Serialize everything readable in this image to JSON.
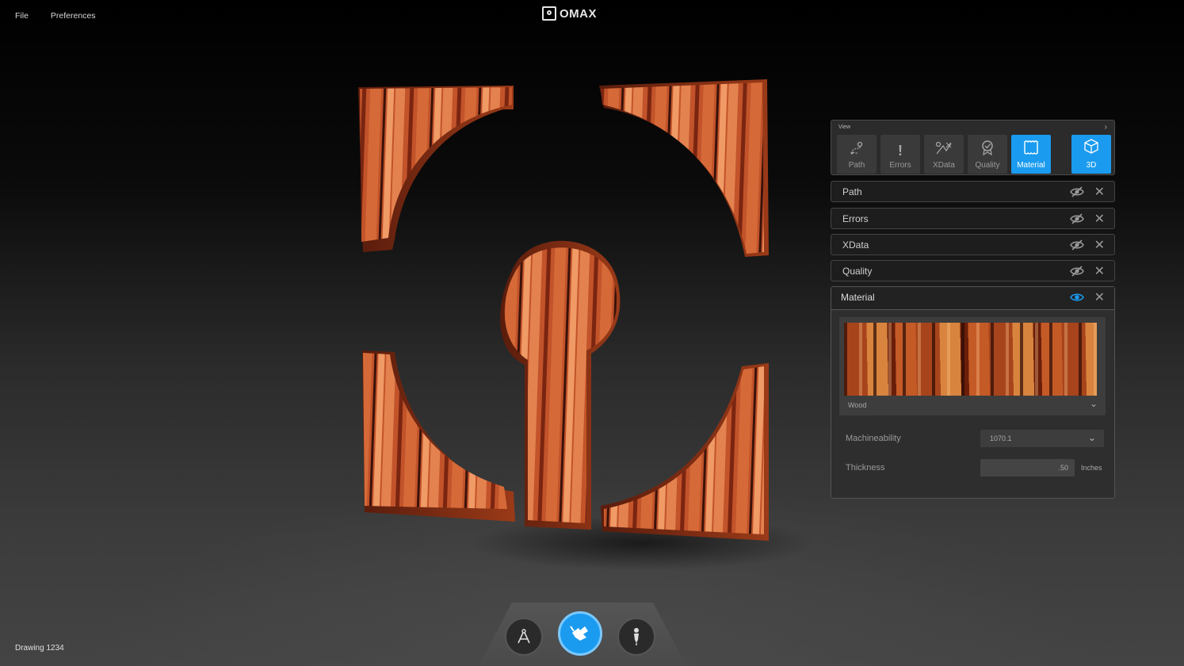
{
  "menu": {
    "file": "File",
    "preferences": "Preferences"
  },
  "brand": {
    "name": "OMAX"
  },
  "view_panel": {
    "label": "View",
    "buttons": [
      {
        "label": "Path",
        "icon": "path-icon"
      },
      {
        "label": "Errors",
        "icon": "exclamation-icon"
      },
      {
        "label": "XData",
        "icon": "xdata-icon"
      },
      {
        "label": "Quality",
        "icon": "ribbon-icon"
      },
      {
        "label": "Material",
        "icon": "material-icon",
        "active": true
      }
    ],
    "three_d": {
      "label": "3D",
      "icon": "cube-icon",
      "active": true
    }
  },
  "layers": [
    {
      "name": "Path",
      "visible": false
    },
    {
      "name": "Errors",
      "visible": false
    },
    {
      "name": "XData",
      "visible": false
    },
    {
      "name": "Quality",
      "visible": false
    }
  ],
  "material": {
    "title": "Material",
    "visible": true,
    "swatch_name": "Wood",
    "machineability_label": "Machineability",
    "machineability_value": "1070.1",
    "thickness_label": "Thickness",
    "thickness_value": ".50",
    "thickness_unit": "Inches"
  },
  "footer": {
    "drawing_name": "Drawing 1234"
  },
  "colors": {
    "accent": "#1a9bef",
    "panel_bg": "#2b2b2b",
    "wood_dark": "#8a2c12",
    "wood_light": "#e07a4c"
  }
}
